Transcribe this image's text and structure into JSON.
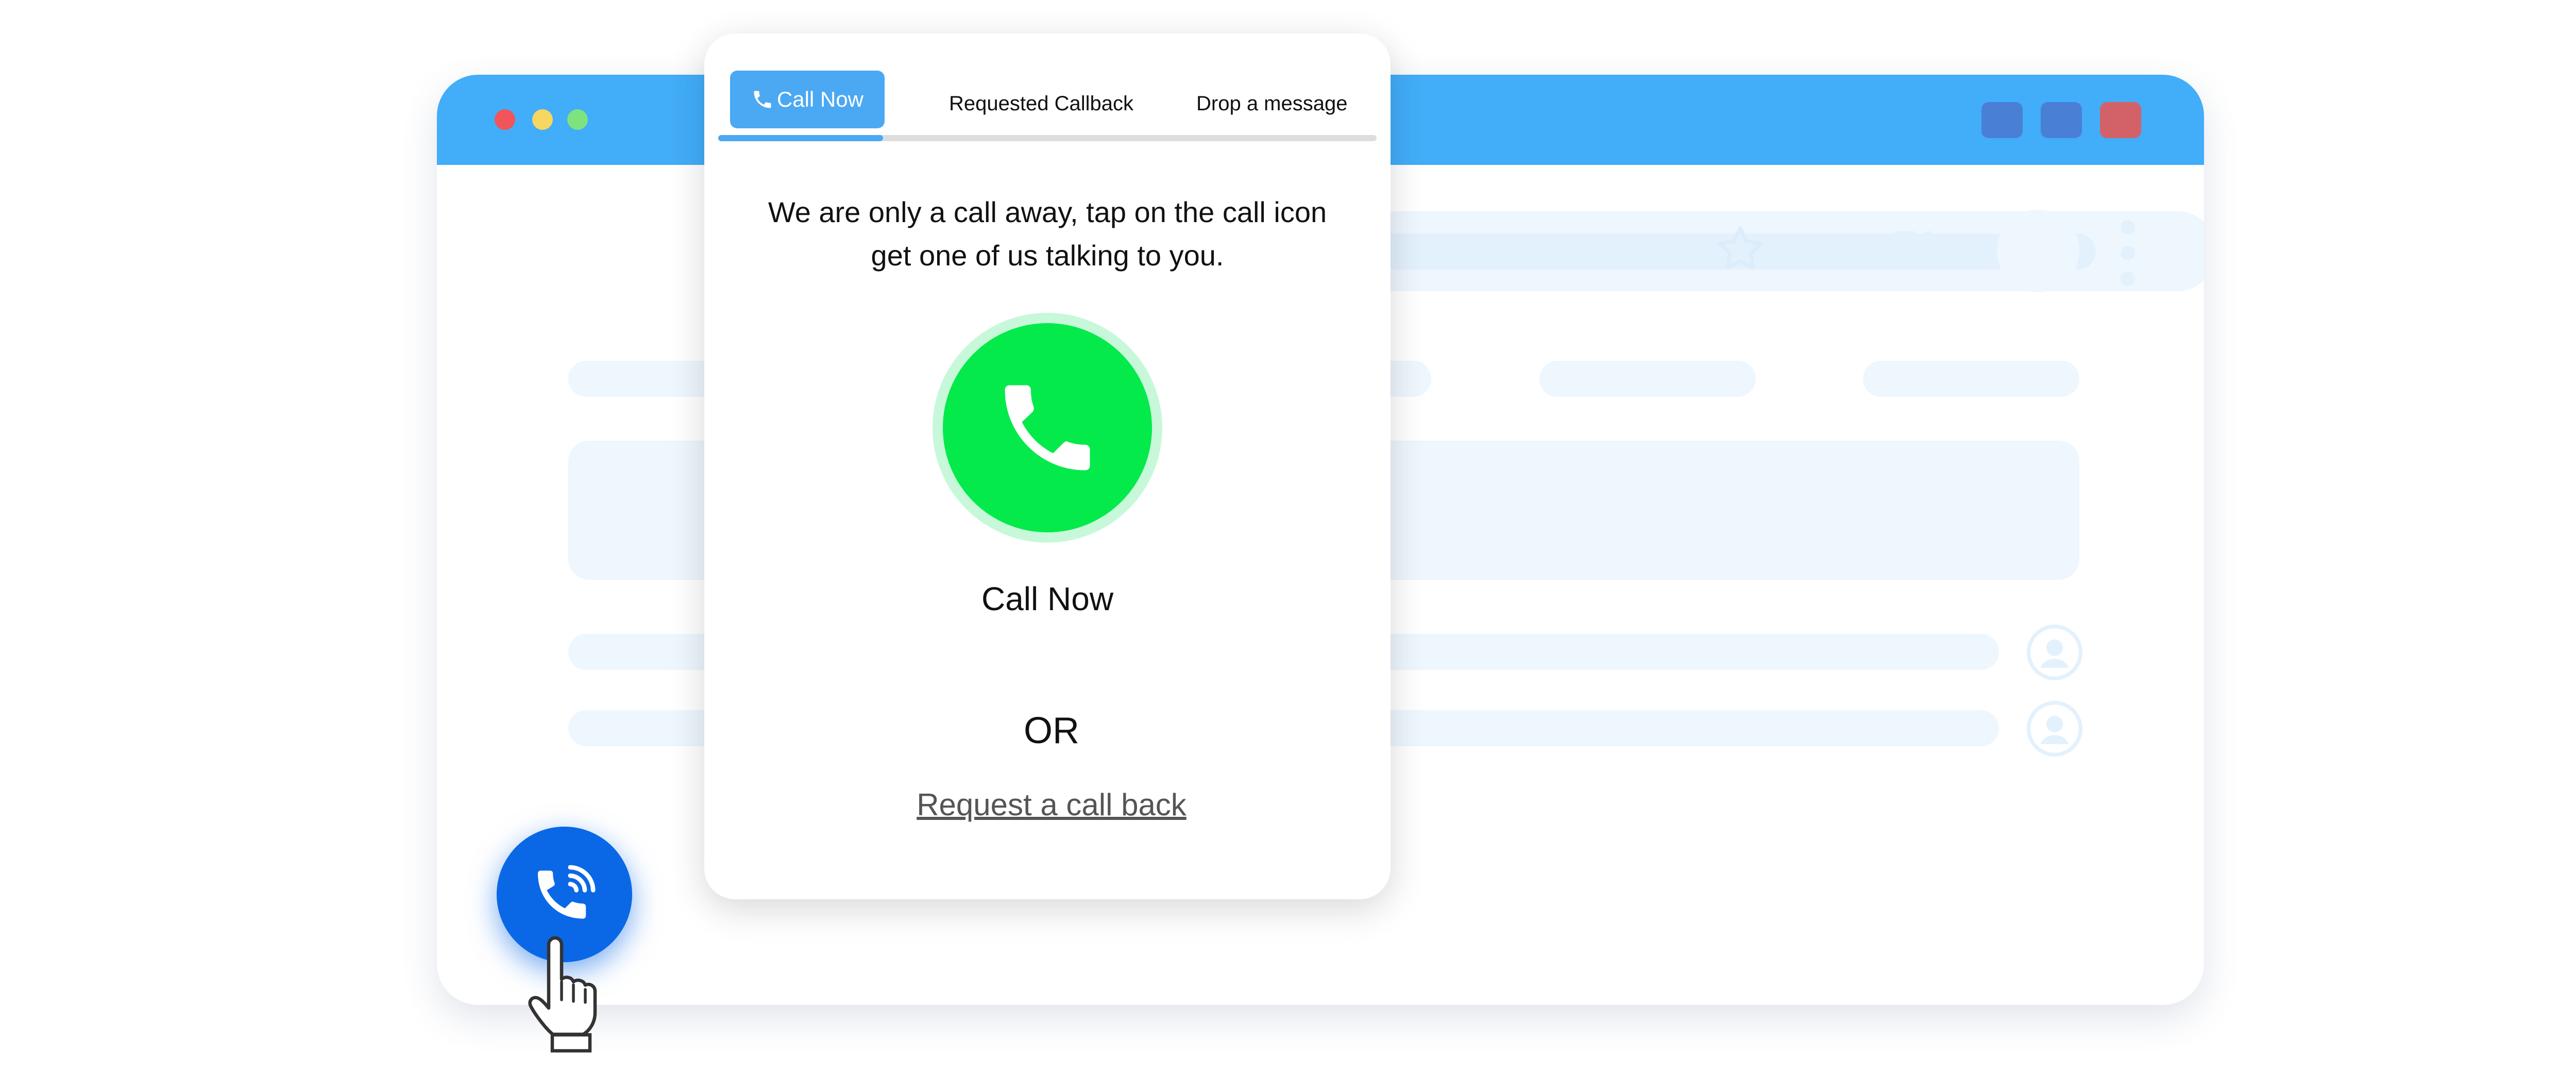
{
  "colors": {
    "titlebar": "#42adf9",
    "accent": "#4ba8f3",
    "call_green": "#03ea4a",
    "fab_blue": "#0a68e6",
    "dot_red": "#f2545b",
    "dot_yellow": "#f7d760",
    "dot_green": "#7ee37e"
  },
  "browser": {
    "icons": [
      "star-icon",
      "puzzle-icon",
      "kebab-menu-icon",
      "user-icon"
    ]
  },
  "popup": {
    "tabs": [
      {
        "label": "Call Now",
        "icon": "phone-icon",
        "active": true
      },
      {
        "label": "Requested Callback",
        "active": false
      },
      {
        "label": "Drop a message",
        "active": false
      }
    ],
    "progress": 0.25,
    "message": "We are only a call away, tap on the call icon get one of us talking to you.",
    "call_label": "Call Now",
    "or_label": "OR",
    "callback_link": "Request a call back"
  },
  "fab": {
    "icon": "phone-wifi-icon"
  },
  "cursor": {
    "icon": "hand-pointer-icon"
  }
}
